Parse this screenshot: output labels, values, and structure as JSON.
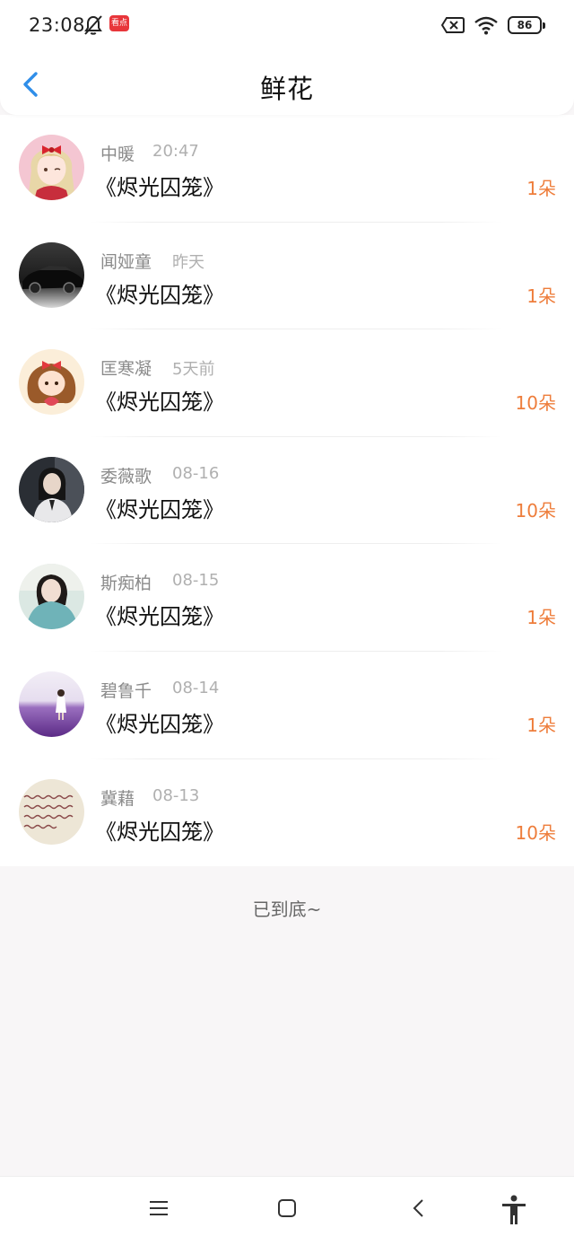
{
  "status_bar": {
    "time": "23:08",
    "app_badge": "看点",
    "battery": "86"
  },
  "header": {
    "title": "鲜花"
  },
  "list": {
    "items": [
      {
        "name": "中暖",
        "time": "20:47",
        "book": "《烬光囚笼》",
        "count": "1朵",
        "avatar": "anime-girl-avatar"
      },
      {
        "name": "闻娅童",
        "time": "昨天",
        "book": "《烬光囚笼》",
        "count": "1朵",
        "avatar": "black-car-avatar"
      },
      {
        "name": "匡寒凝",
        "time": "5天前",
        "book": "《烬光囚笼》",
        "count": "10朵",
        "avatar": "cartoon-heart-girl-avatar"
      },
      {
        "name": "委薇歌",
        "time": "08-16",
        "book": "《烬光囚笼》",
        "count": "10朵",
        "avatar": "dark-portrait-avatar"
      },
      {
        "name": "斯痴柏",
        "time": "08-15",
        "book": "《烬光囚笼》",
        "count": "1朵",
        "avatar": "girl-teal-avatar"
      },
      {
        "name": "碧鲁千",
        "time": "08-14",
        "book": "《烬光囚笼》",
        "count": "1朵",
        "avatar": "lavender-field-avatar"
      },
      {
        "name": "冀藉",
        "time": "08-13",
        "book": "《烬光囚笼》",
        "count": "10朵",
        "avatar": "handwriting-note-avatar"
      }
    ],
    "end_text": "已到底~"
  },
  "colors": {
    "accent_blue": "#2f8ee9",
    "count_orange": "#ee7d3b",
    "background": "#f8f6f7"
  }
}
